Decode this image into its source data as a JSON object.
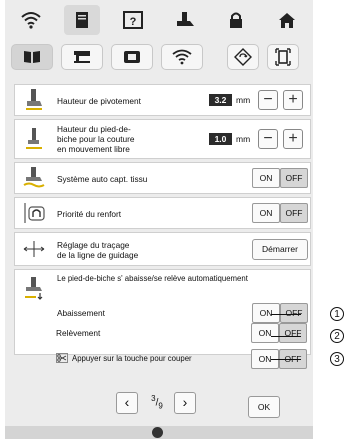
{
  "tabs": [
    {
      "icon": "wifi-icon"
    },
    {
      "icon": "document-icon"
    },
    {
      "icon": "help-icon"
    },
    {
      "icon": "presser-foot-icon"
    },
    {
      "icon": "lock-icon"
    },
    {
      "icon": "home-icon"
    }
  ],
  "subtabs": [
    {
      "icon": "book-settings-icon"
    },
    {
      "icon": "sewing-machine-icon"
    },
    {
      "icon": "embroidery-screen-icon"
    },
    {
      "icon": "wifi-settings-icon"
    },
    {
      "icon": "reset-icon"
    },
    {
      "icon": "save-icon"
    }
  ],
  "settings": {
    "pivot": {
      "label": "Hauteur de pivotement",
      "value": "3.2",
      "unit": "mm"
    },
    "free_motion": {
      "label_lines": [
        "Hauteur du pied-de-",
        "biche pour la couture",
        "en mouvement libre"
      ],
      "value": "1.0",
      "unit": "mm"
    },
    "auto_sensor": {
      "label": "Système auto capt. tissu",
      "on": "ON",
      "off": "OFF",
      "selected": "OFF"
    },
    "reinforce": {
      "label": "Priorité du renfort",
      "on": "ON",
      "off": "OFF",
      "selected": "OFF"
    },
    "guide": {
      "label_lines": [
        "Réglage du traçage",
        "de la ligne de guidage"
      ],
      "button": "Démarrer"
    },
    "auto_lift": {
      "title": "Le pied-de-biche s' abaisse/se relève automatiquement",
      "lowering": {
        "label": "Abaissement",
        "on": "ON",
        "off": "OFF",
        "selected": "OFF"
      },
      "raising": {
        "label": "Relèvement",
        "on": "ON",
        "off": "OFF",
        "selected": "OFF"
      },
      "cutting": {
        "label": "Appuyer sur la touche pour couper",
        "on": "ON",
        "off": "OFF",
        "selected": "OFF"
      }
    }
  },
  "pager": {
    "current": "3",
    "total": "9",
    "ok": "OK"
  },
  "callouts": [
    "1",
    "2",
    "3"
  ]
}
